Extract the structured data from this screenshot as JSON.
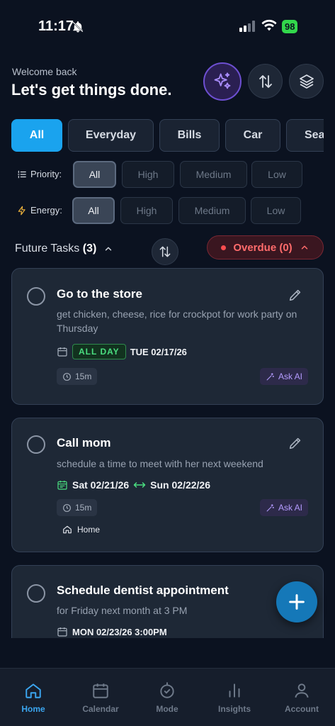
{
  "status": {
    "time": "11:17",
    "battery": "98"
  },
  "header": {
    "welcome": "Welcome back",
    "headline": "Let's get things done."
  },
  "categories": [
    "All",
    "Everyday",
    "Bills",
    "Car",
    "Sea"
  ],
  "priority": {
    "label": "Priority:",
    "options": [
      "All",
      "High",
      "Medium",
      "Low"
    ]
  },
  "energy": {
    "label": "Energy:",
    "options": [
      "All",
      "High",
      "Medium",
      "Low"
    ]
  },
  "future": {
    "label": "Future Tasks",
    "count": "(3)"
  },
  "overdue": {
    "label": "Overdue (0)"
  },
  "tasks": [
    {
      "title": "Go to the store",
      "desc": "get chicken, cheese, rice for crockpot for work party on Thursday",
      "badge": "ALL DAY",
      "date": "TUE 02/17/26",
      "duration": "15m",
      "ask": "Ask AI"
    },
    {
      "title": "Call mom",
      "desc": "schedule a time to meet with her next weekend",
      "date_start": "Sat 02/21/26",
      "date_end": "Sun 02/22/26",
      "duration": "15m",
      "ask": "Ask AI",
      "location": "Home"
    },
    {
      "title": "Schedule dentist appointment",
      "desc": "for Friday next month at 3 PM",
      "date": "MON 02/23/26 3:00PM"
    }
  ],
  "nav": [
    "Home",
    "Calendar",
    "Mode",
    "Insights",
    "Account"
  ],
  "colors": {
    "accent": "#1aa3ee",
    "overdue": "#ff6b6b",
    "allday": "#4ade80",
    "ai": "#b59cff"
  }
}
